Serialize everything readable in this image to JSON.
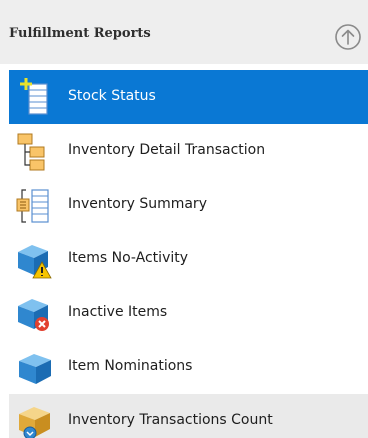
{
  "header": {
    "title": "Fulfillment Reports",
    "collapse_icon": "arrow-up-circle-icon"
  },
  "items": [
    {
      "label": "Stock Status",
      "icon": "add-list-icon",
      "state": "selected"
    },
    {
      "label": "Inventory Detail Transaction",
      "icon": "hierarchy-icon",
      "state": "normal"
    },
    {
      "label": "Inventory Summary",
      "icon": "summary-list-icon",
      "state": "normal"
    },
    {
      "label": "Items No-Activity",
      "icon": "box-warning-icon",
      "state": "normal"
    },
    {
      "label": "Inactive Items",
      "icon": "box-error-icon",
      "state": "normal"
    },
    {
      "label": "Item Nominations",
      "icon": "box-icon",
      "state": "normal"
    },
    {
      "label": "Inventory Transactions Count",
      "icon": "box-transactions-icon",
      "state": "hover"
    }
  ],
  "colors": {
    "selected_bg": "#0a78d4",
    "header_bg": "#eeeeee",
    "hover_bg": "#eaeaea"
  }
}
